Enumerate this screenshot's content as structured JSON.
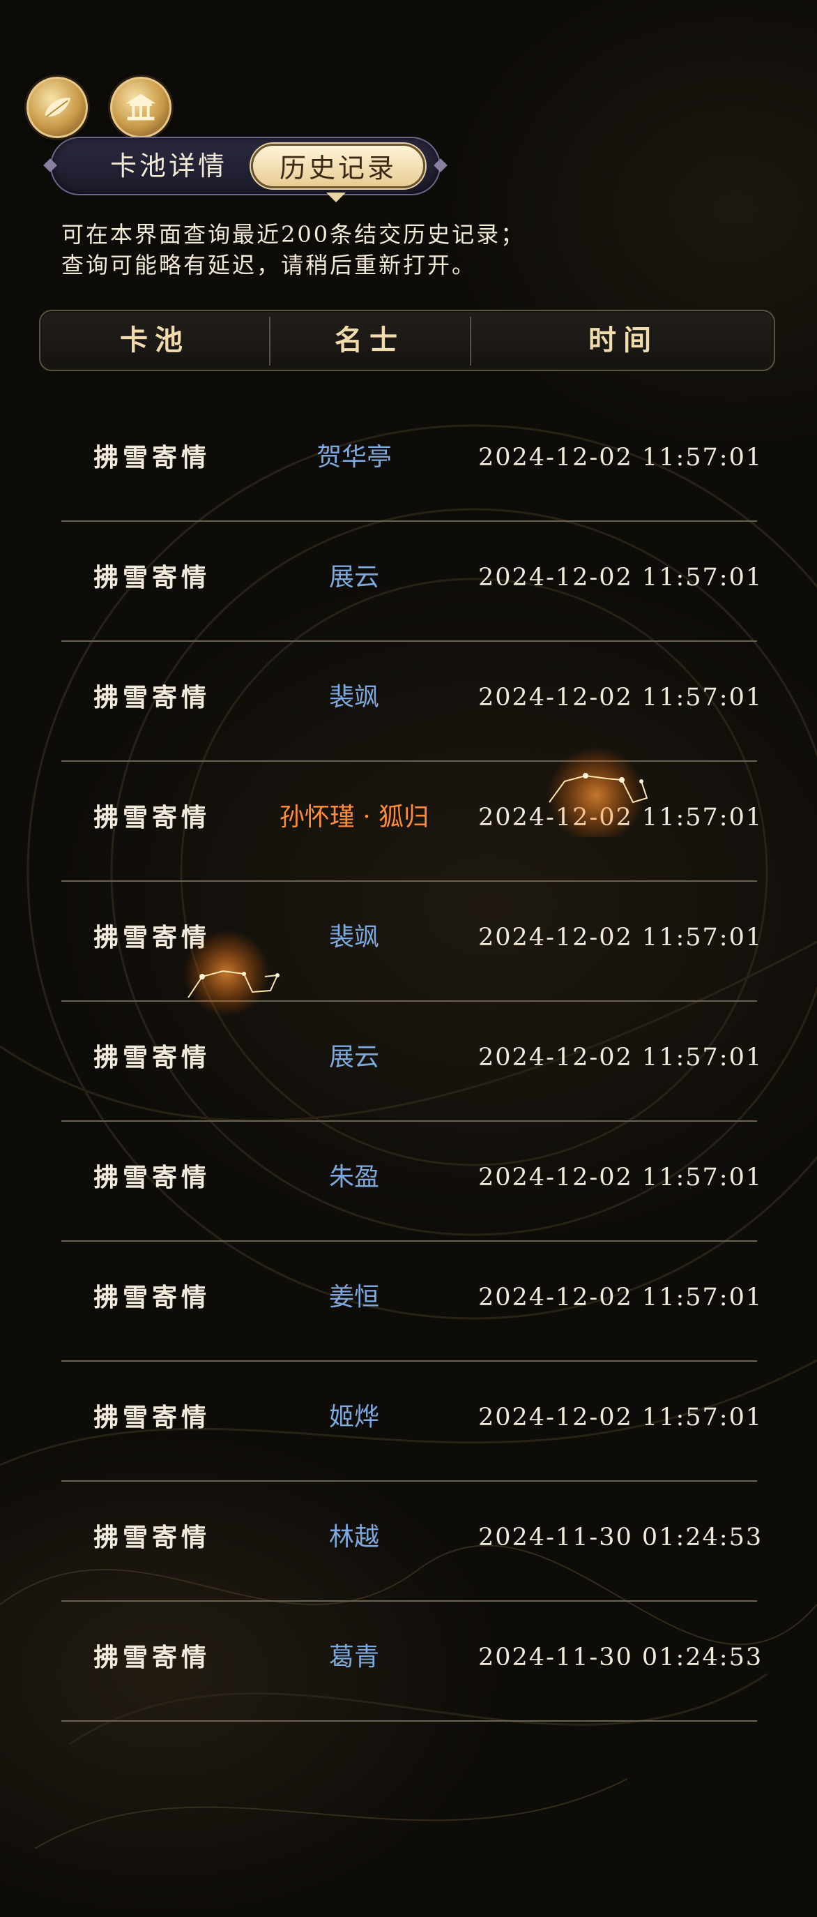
{
  "tabs": {
    "pool_label": "卡池详情",
    "history_label": "历史记录"
  },
  "description": {
    "line1": "可在本界面查询最近200条结交历史记录；",
    "line2": "查询可能略有延迟，请稍后重新打开。"
  },
  "table": {
    "headers": {
      "pool": "卡池",
      "hero": "名士",
      "time": "时间"
    },
    "rows": [
      {
        "pool": "拂雪寄情",
        "hero": "贺华亭",
        "time": "2024-12-02 11:57:01"
      },
      {
        "pool": "拂雪寄情",
        "hero": "展云",
        "time": "2024-12-02 11:57:01"
      },
      {
        "pool": "拂雪寄情",
        "hero": "裴飒",
        "time": "2024-12-02 11:57:01"
      },
      {
        "pool": "拂雪寄情",
        "hero": "孙怀瑾 · 狐归",
        "time": "2024-12-02 11:57:01"
      },
      {
        "pool": "拂雪寄情",
        "hero": "裴飒",
        "time": "2024-12-02 11:57:01"
      },
      {
        "pool": "拂雪寄情",
        "hero": "展云",
        "time": "2024-12-02 11:57:01"
      },
      {
        "pool": "拂雪寄情",
        "hero": "朱盈",
        "time": "2024-12-02 11:57:01"
      },
      {
        "pool": "拂雪寄情",
        "hero": "姜恒",
        "time": "2024-12-02 11:57:01"
      },
      {
        "pool": "拂雪寄情",
        "hero": "姬烨",
        "time": "2024-12-02 11:57:01"
      },
      {
        "pool": "拂雪寄情",
        "hero": "林越",
        "time": "2024-11-30 01:24:53"
      },
      {
        "pool": "拂雪寄情",
        "hero": "葛青",
        "time": "2024-11-30 01:24:53"
      }
    ]
  },
  "icons": {
    "top_left": "leaf-emblem-icon",
    "top_right": "pavilion-icon"
  },
  "colors": {
    "hero_normal": "#7ea9de",
    "hero_rare": "#ff8c3a",
    "header_text": "#f2dcae"
  }
}
